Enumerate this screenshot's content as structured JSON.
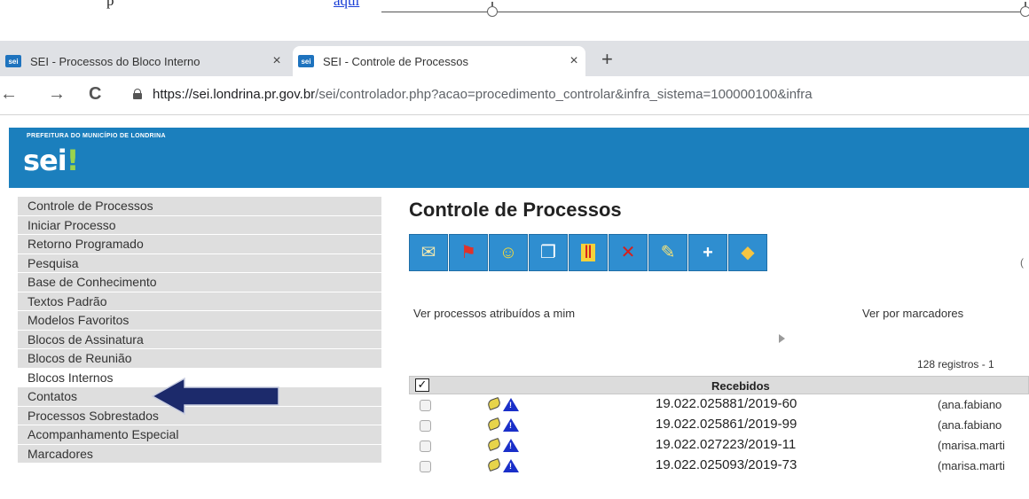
{
  "document": {
    "text": "p",
    "link": "aqui"
  },
  "browser": {
    "tabs": [
      {
        "label": "SEI - Processos do Bloco Interno",
        "close": "×",
        "active": false
      },
      {
        "label": "SEI - Controle de Processos",
        "close": "×",
        "active": true
      }
    ],
    "new_tab": "+",
    "favicon_text": "sei",
    "nav": {
      "back": "←",
      "forward": "→",
      "reload": "C"
    },
    "url_host": "https://sei.londrina.pr.gov.br",
    "url_path": "/sei/controlador.php?acao=procedimento_controlar&infra_sistema=100000100&infra"
  },
  "header": {
    "org": "PREFEITURA DO MUNICÍPIO DE LONDRINA",
    "logo": "sei",
    "logo_mark": "!",
    "color": "#1b7fbd"
  },
  "sidebar": {
    "items": [
      {
        "label": "Controle de Processos",
        "selected": false
      },
      {
        "label": "Iniciar Processo",
        "selected": false
      },
      {
        "label": "Retorno Programado",
        "selected": false
      },
      {
        "label": "Pesquisa",
        "selected": false
      },
      {
        "label": "Base de Conhecimento",
        "selected": false
      },
      {
        "label": "Textos Padrão",
        "selected": false
      },
      {
        "label": "Modelos Favoritos",
        "selected": false
      },
      {
        "label": "Blocos de Assinatura",
        "selected": false
      },
      {
        "label": "Blocos de Reunião",
        "selected": false
      },
      {
        "label": "Blocos Internos",
        "selected": true
      },
      {
        "label": "Contatos",
        "selected": false
      },
      {
        "label": "Processos Sobrestados",
        "selected": false
      },
      {
        "label": "Acompanhamento Especial",
        "selected": false
      },
      {
        "label": "Marcadores",
        "selected": false
      }
    ]
  },
  "main": {
    "title": "Controle de Processos",
    "toolbar": [
      {
        "icon": "send-process-icon",
        "glyph": "✉"
      },
      {
        "icon": "update-progress-icon",
        "glyph": "⚑"
      },
      {
        "icon": "assign-process-icon",
        "glyph": "☺"
      },
      {
        "icon": "generate-pdf-icon",
        "glyph": "❐"
      },
      {
        "icon": "suspend-process-icon",
        "glyph": "Ⅱ"
      },
      {
        "icon": "conclude-process-icon",
        "glyph": "✕"
      },
      {
        "icon": "annotations-icon",
        "glyph": "✎"
      },
      {
        "icon": "new-document-icon",
        "glyph": "+"
      },
      {
        "icon": "marker-tag-icon",
        "glyph": "◆"
      }
    ],
    "edge_mark": "(",
    "link_assigned": "Ver processos atribuídos a mim",
    "link_markers": "Ver por marcadores",
    "records": "128 registros - 1",
    "table": {
      "header_check": "✓",
      "header": "Recebidos",
      "rows": [
        {
          "number": "19.022.025881/2019-60",
          "user": "(ana.fabiano"
        },
        {
          "number": "19.022.025861/2019-99",
          "user": "(ana.fabiano"
        },
        {
          "number": "19.022.027223/2019-11",
          "user": "(marisa.marti"
        },
        {
          "number": "19.022.025093/2019-73",
          "user": "(marisa.marti"
        }
      ]
    }
  }
}
